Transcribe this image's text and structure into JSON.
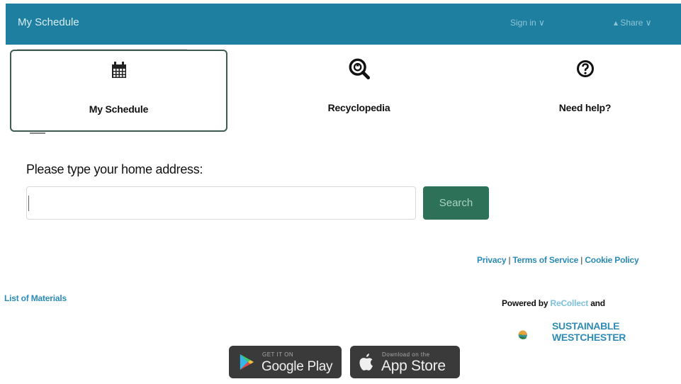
{
  "header": {
    "title": "My Schedule",
    "menu_1": "Sign in ∨",
    "menu_2": "▴ Share ∨"
  },
  "tabs": [
    {
      "label": "My Schedule",
      "icon": "calendar-icon",
      "active": true
    },
    {
      "label": "Recyclopedia",
      "icon": "search-recycle-icon",
      "active": false
    },
    {
      "label": "Need help?",
      "icon": "help-icon",
      "active": false
    }
  ],
  "address": {
    "prompt": "Please type your home address:",
    "value": "",
    "search_label": "Search"
  },
  "footer": {
    "privacy": "Privacy",
    "terms": "Terms of Service",
    "cookie": "Cookie Policy",
    "sep": "|",
    "materials": "List of Materials",
    "powered_by": "Powered by",
    "brand": "ReCollect",
    "and": "and",
    "partner_line1": "SUSTAINABLE",
    "partner_line2": "WESTCHESTER"
  },
  "stores": {
    "google_small": "GET IT ON",
    "google_big": "Google Play",
    "apple_small": "Download on the",
    "apple_big": "App Store"
  },
  "colors": {
    "header_bg": "#1e7fa0",
    "search_button": "#2d7258",
    "link": "#2a8bb8"
  }
}
